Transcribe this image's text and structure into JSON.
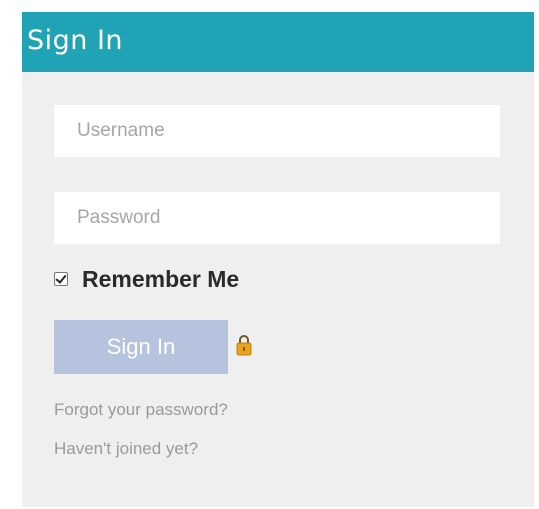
{
  "header": {
    "title": "Sign In"
  },
  "form": {
    "username": {
      "placeholder": "Username",
      "value": ""
    },
    "password": {
      "placeholder": "Password",
      "value": ""
    },
    "remember_label": "Remember Me",
    "remember_checked": true,
    "submit_label": "Sign In"
  },
  "links": {
    "forgot": "Forgot your password?",
    "join": "Haven't joined yet?"
  },
  "icons": {
    "submit_adornment": "lock-icon"
  },
  "colors": {
    "header": "#1fa3b5",
    "panel": "#efefef",
    "button": "#b6c3de",
    "lock": "#e8a41b"
  }
}
